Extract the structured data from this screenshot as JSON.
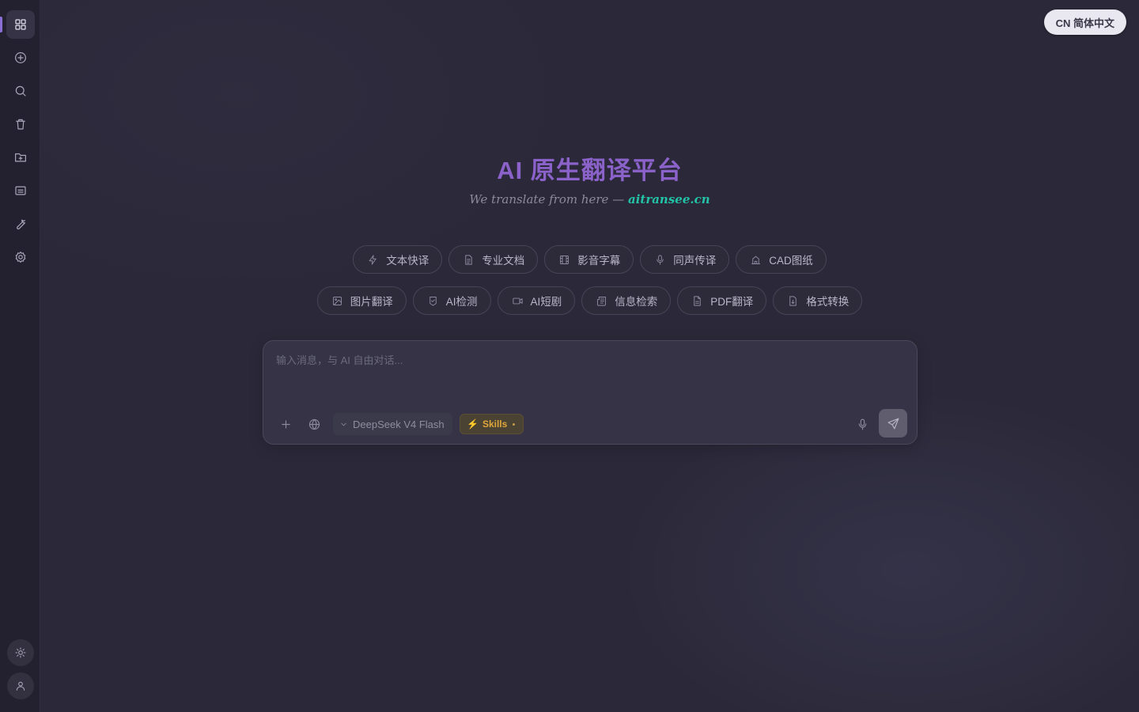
{
  "sidebar": {
    "items": [
      {
        "icon": "grid-icon",
        "active": true
      },
      {
        "icon": "plus-circle-icon"
      },
      {
        "icon": "search-icon"
      },
      {
        "icon": "trash-icon"
      },
      {
        "icon": "folder-plus-icon"
      },
      {
        "icon": "subtitles-icon"
      },
      {
        "icon": "wrench-icon"
      },
      {
        "icon": "gear-icon"
      }
    ],
    "bottom": [
      {
        "icon": "sun-icon"
      },
      {
        "icon": "user-icon"
      }
    ],
    "accent": "#8b6fd6"
  },
  "header": {
    "language_label": "CN 简体中文"
  },
  "hero": {
    "title": "AI 原生翻译平台",
    "subtitle_prefix": "We translate from here — ",
    "subtitle_domain": "aitransee.cn",
    "title_color": "#8a62c9",
    "domain_color": "#22c3a7"
  },
  "tools": {
    "row1": [
      {
        "label": "文本快译",
        "icon": "zap-icon"
      },
      {
        "label": "专业文档",
        "icon": "file-text-icon"
      },
      {
        "label": "影音字幕",
        "icon": "film-icon"
      },
      {
        "label": "同声传译",
        "icon": "mic-icon"
      },
      {
        "label": "CAD图纸",
        "icon": "building-icon"
      }
    ],
    "row2": [
      {
        "label": "图片翻译",
        "icon": "image-icon"
      },
      {
        "label": "AI检测",
        "icon": "shield-check-icon"
      },
      {
        "label": "AI短剧",
        "icon": "video-icon"
      },
      {
        "label": "信息检索",
        "icon": "newspaper-icon"
      },
      {
        "label": "PDF翻译",
        "icon": "file-icon"
      },
      {
        "label": "格式转换",
        "icon": "file-convert-icon"
      }
    ]
  },
  "chat": {
    "placeholder": "输入消息，与 AI 自由对话...",
    "model": "DeepSeek V4 Flash",
    "skills_label": "Skills",
    "skills_color": "#e0a63b"
  }
}
